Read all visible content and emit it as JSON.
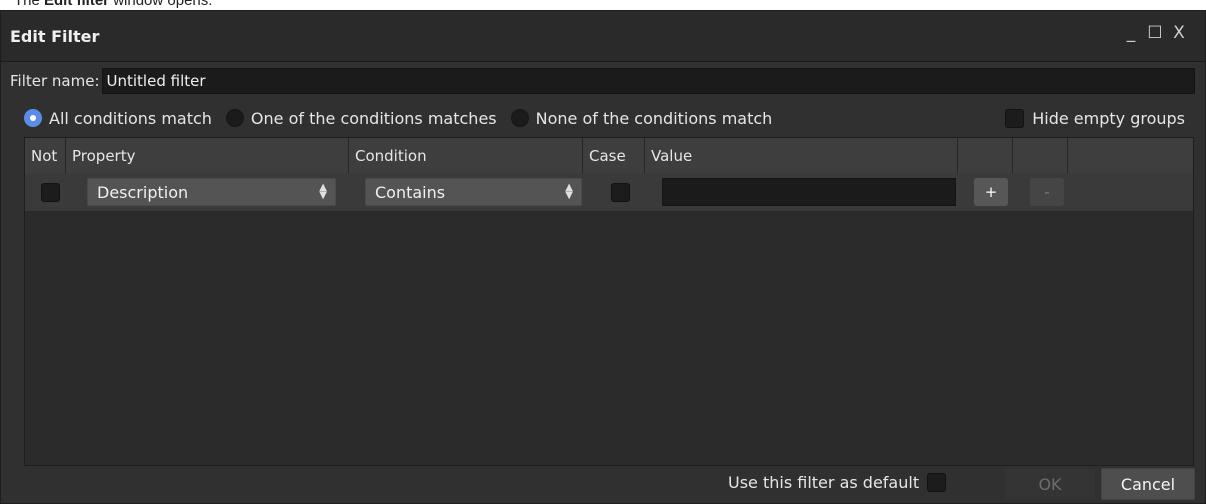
{
  "caption": {
    "prefix": "The ",
    "bold": "Edit filter",
    "suffix": " window opens."
  },
  "window": {
    "title": "Edit Filter",
    "controls": {
      "minimize": "_",
      "maximize": "☐",
      "close": "X"
    }
  },
  "filter_name": {
    "label": "Filter name:",
    "value": "Untitled filter"
  },
  "match_options": [
    {
      "label": "All conditions match",
      "selected": true
    },
    {
      "label": "One of the conditions matches",
      "selected": false
    },
    {
      "label": "None of the conditions match",
      "selected": false
    }
  ],
  "hide_empty_groups": {
    "label": "Hide empty groups",
    "checked": false
  },
  "table": {
    "columns": [
      "Not",
      "Property",
      "Condition",
      "Case",
      "Value",
      "",
      ""
    ],
    "rows": [
      {
        "not": false,
        "property": "Description",
        "condition": "Contains",
        "case": false,
        "value": "",
        "add_label": "+",
        "remove_label": "-"
      }
    ]
  },
  "footer": {
    "default_label": "Use this filter as default",
    "default_checked": false,
    "ok_label": "OK",
    "cancel_label": "Cancel"
  },
  "colors": {
    "accent": "#5b8de6",
    "window_bg": "#303030",
    "input_bg": "#1b1b1b"
  }
}
